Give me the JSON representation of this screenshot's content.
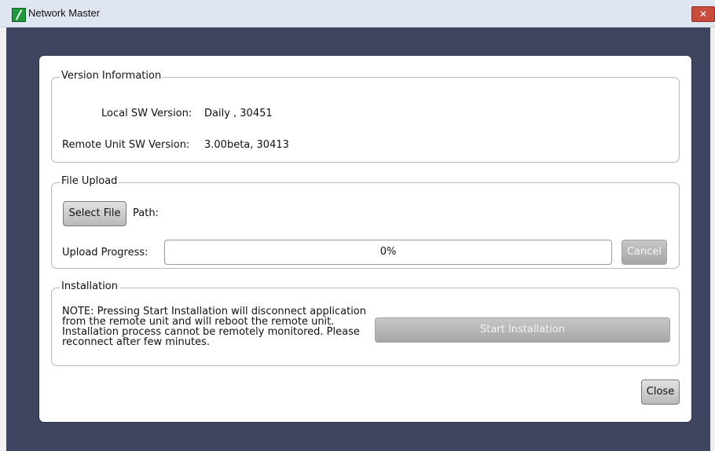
{
  "window": {
    "title": "Network Master",
    "logo_icon": "app-logo-icon",
    "close_icon": "close-icon",
    "close_symbol": "✕"
  },
  "version": {
    "group_label": "Version Information",
    "local_label": "Local SW Version:",
    "local_value": "Daily , 30451",
    "remote_label": "Remote Unit SW Version:",
    "remote_value": "3.00beta, 30413"
  },
  "upload": {
    "group_label": "File Upload",
    "select_button": "Select File",
    "path_label": "Path:",
    "path_value": "",
    "progress_label": "Upload Progress:",
    "progress_text": "0%",
    "progress_percent": 0,
    "cancel_button": "Cancel"
  },
  "install": {
    "group_label": "Installation",
    "note": "NOTE: Pressing Start Installation will disconnect application from the remote unit and will reboot the remote unit. Installation process cannot be remotely monitored. Please reconnect after few minutes.",
    "start_button": "Start Installation"
  },
  "footer": {
    "close_button": "Close"
  },
  "colors": {
    "frame_background": "#3f4461",
    "dialog_background": "#ffffff",
    "close_red": "#c94b3d"
  }
}
